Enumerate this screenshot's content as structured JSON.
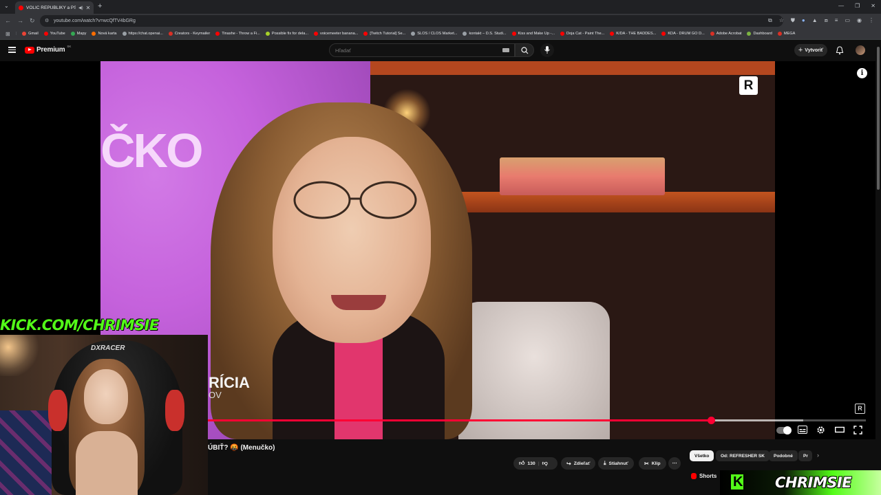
{
  "browser": {
    "tab_title": "VOLIČ REPUBLIKY a PS-ka...",
    "new_tab_glyph": "+",
    "url": "youtube.com/watch?v=wcQfTV4bGRg",
    "bookmarks": [
      {
        "label": "Gmail",
        "color": "#ea4335"
      },
      {
        "label": "YouTube",
        "color": "#ff0000"
      },
      {
        "label": "Mapy",
        "color": "#34a853"
      },
      {
        "label": "Nová karta",
        "color": "#ff6d00"
      },
      {
        "label": "https://chat.openai...",
        "color": "#9aa0a6"
      },
      {
        "label": "Creators - Keymailer",
        "color": "#d93025"
      },
      {
        "label": "Tinashe - Throw a Fi...",
        "color": "#ff0000"
      },
      {
        "label": "Possible fix for dela...",
        "color": "#a7d129"
      },
      {
        "label": "voicemeeter banana...",
        "color": "#ff0000"
      },
      {
        "label": "[Twitch Tutorial] Se...",
        "color": "#ff0000"
      },
      {
        "label": "SLOS / CLOS Market...",
        "color": "#9aa0a6"
      },
      {
        "label": "kontakt – D.S. Studi...",
        "color": "#9aa0a6"
      },
      {
        "label": "Kiss and Make Up -...",
        "color": "#ff0000"
      },
      {
        "label": "Doja Cat - Paint The...",
        "color": "#ff0000"
      },
      {
        "label": "K/DA - THE BADDES...",
        "color": "#ff0000"
      },
      {
        "label": "KDA - DRUM GO D...",
        "color": "#ff0000"
      },
      {
        "label": "Adobe Acrobat",
        "color": "#d93025"
      },
      {
        "label": "Dashboard",
        "color": "#7cb342"
      },
      {
        "label": "MEGA",
        "color": "#d93025"
      }
    ]
  },
  "youtube": {
    "logo_word": "Premium",
    "region": "SK",
    "search_placeholder": "Hľadať",
    "create_label": "Vytvoriť",
    "video_title": "ÚBIŤ? 🤬 (Menučko)",
    "progress_fraction": 0.765,
    "buffer_fraction": 0.905,
    "like_count": "130",
    "share_label": "Zdieľať",
    "download_label": "Stiahnuť",
    "clip_label": "Klip",
    "chips": [
      "Všetko",
      "Od: REFRESHER SK",
      "Podobné",
      "Pr"
    ],
    "shorts_label": "Shorts"
  },
  "video_overlay": {
    "wall_text": "ČKO",
    "name_text": "RÍCIA",
    "name_sub": "OV",
    "channel_mark": "R"
  },
  "stream_overlay": {
    "kick_url": "KICK.COM/CHRIMSIE",
    "chair_brand": "DXRACER",
    "banner_logo": "K",
    "banner_name": "CHRIMSIE",
    "accent": "#53fc18"
  },
  "icons": [
    "menu-icon",
    "search-icon",
    "mic-icon",
    "keyboard-icon",
    "bell-icon",
    "info-icon",
    "like-icon",
    "dislike-icon",
    "share-icon",
    "download-icon",
    "clip-icon",
    "more-icon",
    "subtitles-icon",
    "settings-icon",
    "theater-icon",
    "fullscreen-icon"
  ]
}
